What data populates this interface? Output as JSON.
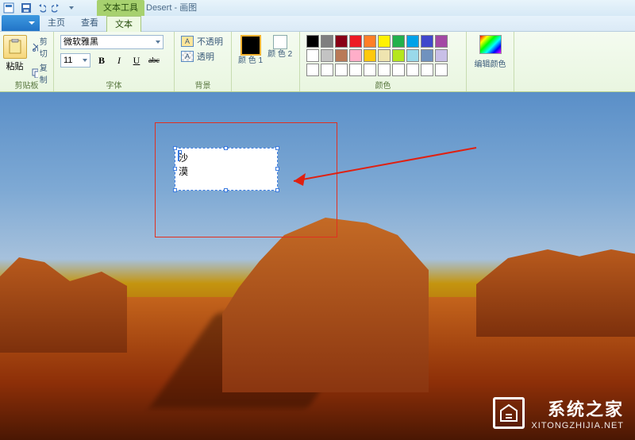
{
  "title": {
    "tool_tab": "文本工具",
    "document": "Desert",
    "app": "画图"
  },
  "tabs": {
    "home": "主页",
    "view": "查看",
    "text": "文本"
  },
  "ribbon": {
    "clipboard": {
      "paste": "粘贴",
      "cut": "剪切",
      "copy": "复制",
      "group": "剪贴板"
    },
    "font": {
      "name": "微软雅黑",
      "size": "11",
      "bold": "B",
      "italic": "I",
      "underline": "U",
      "strike": "abc",
      "group": "字体"
    },
    "background": {
      "opaque": "不透明",
      "transparent": "透明",
      "group": "背景"
    },
    "colors": {
      "color1_label": "颜 色 1",
      "color2_label": "颜 色 2",
      "edit_label": "编辑颜色",
      "group": "颜色"
    },
    "palette": [
      "#000000",
      "#7f7f7f",
      "#880015",
      "#ed1c24",
      "#ff7f27",
      "#fff200",
      "#22b14c",
      "#00a2e8",
      "#3f48cc",
      "#a349a4",
      "#ffffff",
      "#c3c3c3",
      "#b97a57",
      "#ffaec9",
      "#ffc90e",
      "#efe4b0",
      "#b5e61d",
      "#99d9ea",
      "#7092be",
      "#c8bfe7",
      "#ffffff",
      "#ffffff",
      "#ffffff",
      "#ffffff",
      "#ffffff",
      "#ffffff",
      "#ffffff",
      "#ffffff",
      "#ffffff",
      "#ffffff"
    ]
  },
  "canvas": {
    "text_input": "沙漠"
  },
  "watermark": {
    "brand": "系统之家",
    "url": "XITONGZHIJIA.NET"
  }
}
